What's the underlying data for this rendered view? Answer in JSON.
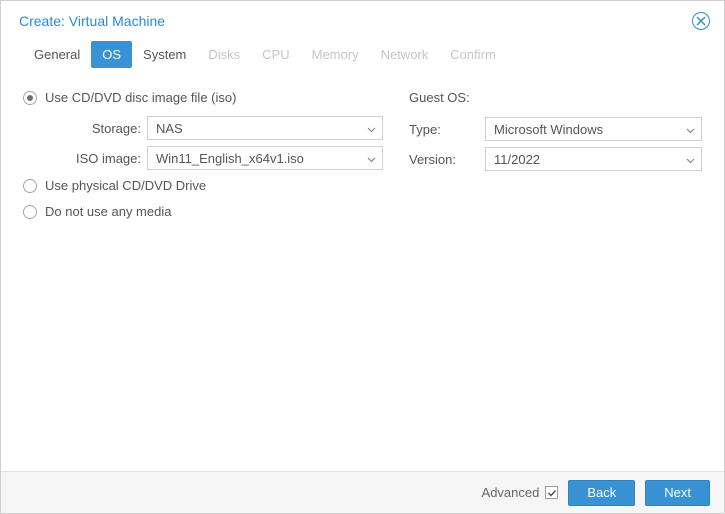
{
  "title": "Create: Virtual Machine",
  "tabs": [
    {
      "label": "General",
      "state": "normal"
    },
    {
      "label": "OS",
      "state": "active"
    },
    {
      "label": "System",
      "state": "normal"
    },
    {
      "label": "Disks",
      "state": "disabled"
    },
    {
      "label": "CPU",
      "state": "disabled"
    },
    {
      "label": "Memory",
      "state": "disabled"
    },
    {
      "label": "Network",
      "state": "disabled"
    },
    {
      "label": "Confirm",
      "state": "disabled"
    }
  ],
  "media": {
    "option_iso": "Use CD/DVD disc image file (iso)",
    "option_physical": "Use physical CD/DVD Drive",
    "option_none": "Do not use any media",
    "storage_label": "Storage:",
    "storage_value": "NAS",
    "iso_label": "ISO image:",
    "iso_value": "Win11_English_x64v1.iso"
  },
  "guest": {
    "heading": "Guest OS:",
    "type_label": "Type:",
    "type_value": "Microsoft Windows",
    "version_label": "Version:",
    "version_value": "11/2022"
  },
  "footer": {
    "advanced_label": "Advanced",
    "back_label": "Back",
    "next_label": "Next"
  }
}
